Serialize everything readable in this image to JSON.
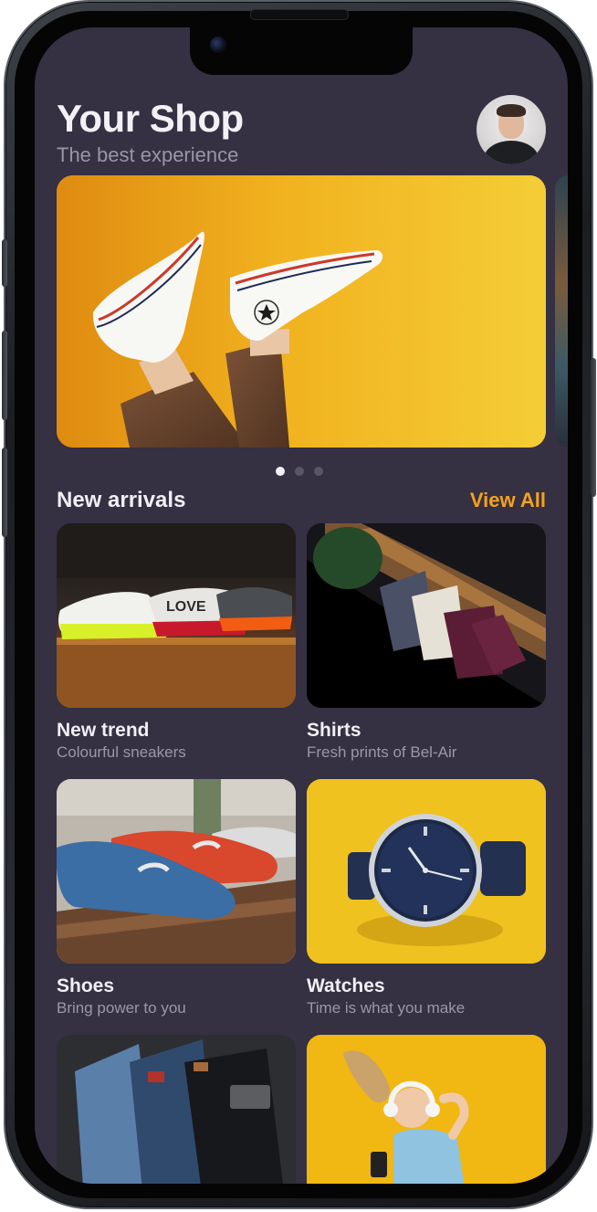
{
  "header": {
    "title": "Your Shop",
    "subtitle": "The best experience"
  },
  "carousel": {
    "slide_count": 3,
    "active_index": 0
  },
  "section": {
    "title": "New arrivals",
    "view_all_label": "View All"
  },
  "products": [
    {
      "name": "New trend",
      "description": "Colourful sneakers"
    },
    {
      "name": "Shirts",
      "description": "Fresh prints of Bel-Air"
    },
    {
      "name": "Shoes",
      "description": "Bring power to you"
    },
    {
      "name": "Watches",
      "description": "Time is what you make"
    }
  ],
  "colors": {
    "screen_background": "#353042",
    "accent": "#f5a21c",
    "title_text": "#f3f1f6",
    "secondary_text": "#9a95a6"
  },
  "icons": {
    "avatar": "user-avatar-photo"
  }
}
